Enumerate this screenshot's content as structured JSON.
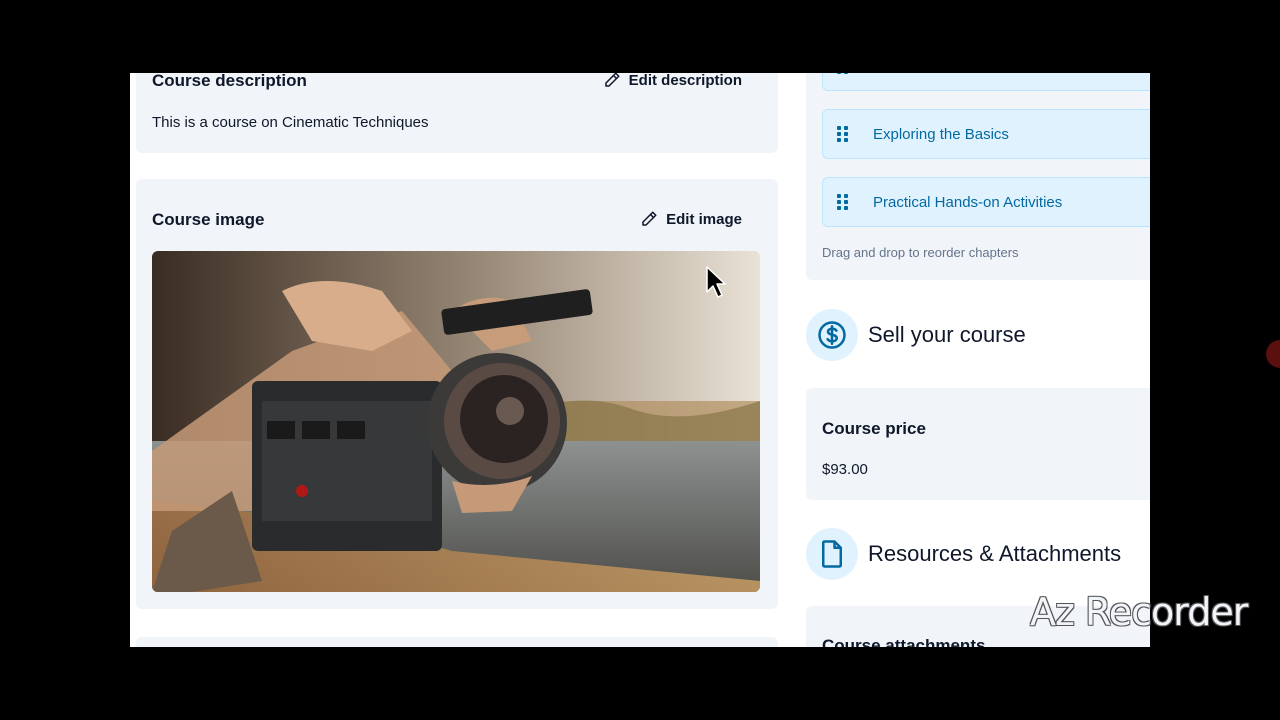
{
  "description": {
    "title": "Course description",
    "edit_label": "Edit description",
    "text": "This is a course on Cinematic Techniques"
  },
  "image": {
    "title": "Course image",
    "edit_label": "Edit image",
    "alt": "Camera operator filming low on a road"
  },
  "chapters": {
    "items": [
      {
        "label": "Exploring the Basics"
      },
      {
        "label": "Practical Hands-on Activities"
      }
    ],
    "hint": "Drag and drop to reorder chapters"
  },
  "sell": {
    "title": "Sell your course",
    "icon": "dollar-circle-icon"
  },
  "price": {
    "label": "Course price",
    "value": "$93.00"
  },
  "resources": {
    "title": "Resources & Attachments",
    "icon": "file-icon"
  },
  "attachments": {
    "label": "Course attachments"
  },
  "overlay": {
    "watermark": "Az Recorder"
  },
  "colors": {
    "accent": "#0369a1",
    "chapter_bg": "#e0f2fe",
    "card_bg": "#f1f5f9"
  }
}
